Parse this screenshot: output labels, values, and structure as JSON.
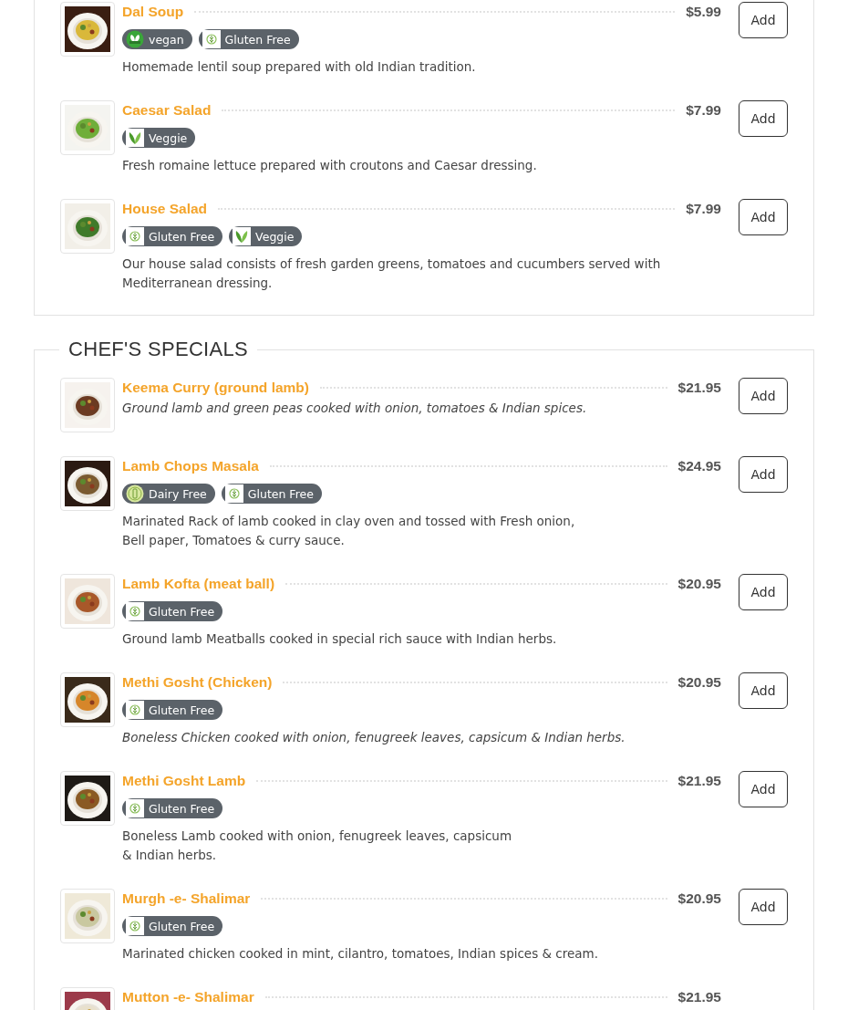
{
  "sections": [
    {
      "items": [
        {
          "name": "Dal Soup",
          "price": "$5.99",
          "button": "Add",
          "italic": false,
          "badges": [
            {
              "kind": "vegan",
              "label": "vegan"
            },
            {
              "kind": "gluten_free",
              "label": "Gluten Free"
            }
          ],
          "description": "Homemade lentil soup prepared with old Indian tradition."
        },
        {
          "name": "Caesar Salad",
          "price": "$7.99",
          "button": "Add",
          "italic": false,
          "badges": [
            {
              "kind": "veggie",
              "label": "Veggie"
            }
          ],
          "description": "Fresh romaine lettuce prepared with croutons and Caesar dressing."
        },
        {
          "name": "House Salad",
          "price": "$7.99",
          "button": "Add",
          "italic": false,
          "badges": [
            {
              "kind": "gluten_free",
              "label": "Gluten Free"
            },
            {
              "kind": "veggie",
              "label": "Veggie"
            }
          ],
          "description": "Our house salad consists of fresh garden greens, tomatoes and cucumbers served with Mediterranean dressing."
        }
      ]
    },
    {
      "title": "CHEF'S SPECIALS",
      "items": [
        {
          "name": "Keema Curry (ground lamb)",
          "price": "$21.95",
          "button": "Add",
          "italic": true,
          "description": "Ground lamb and green peas cooked with onion, tomatoes & Indian spices."
        },
        {
          "name": "Lamb Chops Masala",
          "price": "$24.95",
          "button": "Add",
          "italic": false,
          "badges": [
            {
              "kind": "dairy_free",
              "label": "Dairy Free"
            },
            {
              "kind": "gluten_free",
              "label": "Gluten Free"
            }
          ],
          "description": "Marinated Rack of lamb cooked in clay oven and tossed with Fresh onion,\nBell paper, Tomatoes & curry sauce."
        },
        {
          "name": "Lamb Kofta (meat ball)",
          "price": "$20.95",
          "button": "Add",
          "italic": false,
          "badges": [
            {
              "kind": "gluten_free",
              "label": "Gluten Free"
            }
          ],
          "description": "Ground lamb Meatballs cooked in special rich sauce with Indian herbs."
        },
        {
          "name": "Methi Gosht (Chicken)",
          "price": "$20.95",
          "button": "Add",
          "italic": true,
          "badges": [
            {
              "kind": "gluten_free",
              "label": "Gluten Free"
            }
          ],
          "description": "Boneless Chicken cooked with onion, fenugreek leaves, capsicum & Indian herbs."
        },
        {
          "name": "Methi Gosht Lamb",
          "price": "$21.95",
          "button": "Add",
          "italic": false,
          "badges": [
            {
              "kind": "gluten_free",
              "label": "Gluten Free"
            }
          ],
          "description": "Boneless Lamb cooked with onion, fenugreek leaves, capsicum\n& Indian herbs."
        },
        {
          "name": "Murgh -e- Shalimar",
          "price": "$20.95",
          "button": "Add",
          "italic": false,
          "badges": [
            {
              "kind": "gluten_free",
              "label": "Gluten Free"
            }
          ],
          "description": "Marinated chicken cooked in mint, cilantro, tomatoes, Indian spices & cream."
        },
        {
          "name": "Mutton -e- Shalimar",
          "price": "$21.95"
        }
      ]
    }
  ]
}
